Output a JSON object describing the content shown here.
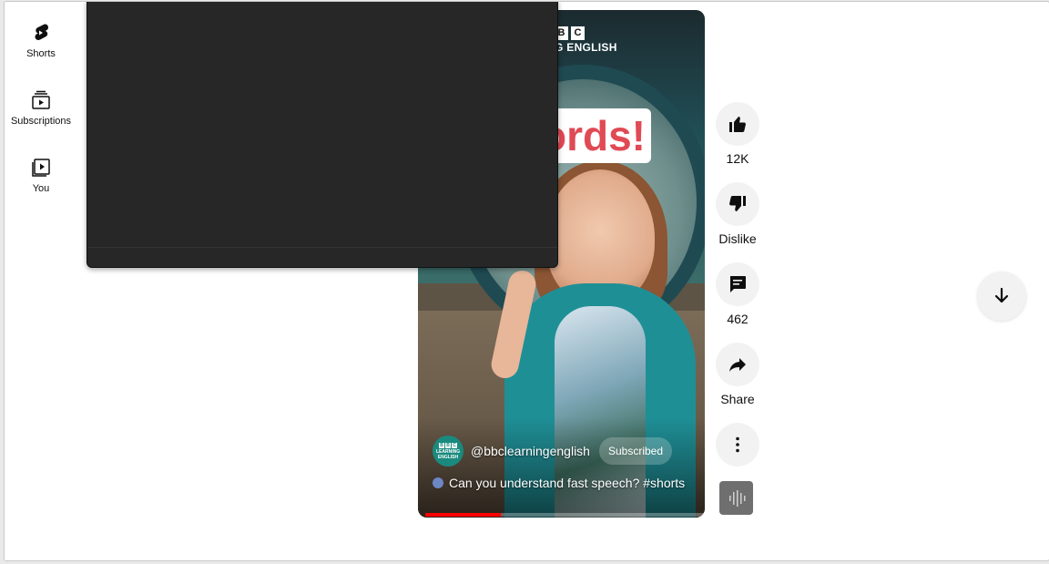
{
  "sidebar": {
    "items": [
      {
        "label": "Shorts",
        "icon": "shorts-icon"
      },
      {
        "label": "Subscriptions",
        "icon": "subscriptions-icon"
      },
      {
        "label": "You",
        "icon": "you-icon"
      }
    ]
  },
  "video": {
    "bbc_letters": [
      "B",
      "C"
    ],
    "bbc_caption": "G ENGLISH",
    "card_text": "ords!",
    "channel_name": "@bbclearningenglish",
    "channel_avatar_text": "LEARNING ENGLISH",
    "channel_avatar_letters": [
      "B",
      "B",
      "C"
    ],
    "subscribe_label": "Subscribed",
    "title": "Can you understand fast speech? #shorts",
    "progress_fraction": 0.27
  },
  "actions": {
    "like_count": "12K",
    "dislike_label": "Dislike",
    "comment_count": "462",
    "share_label": "Share"
  },
  "colors": {
    "progress": "#ff0000",
    "accent_card_text": "#e04a55"
  }
}
